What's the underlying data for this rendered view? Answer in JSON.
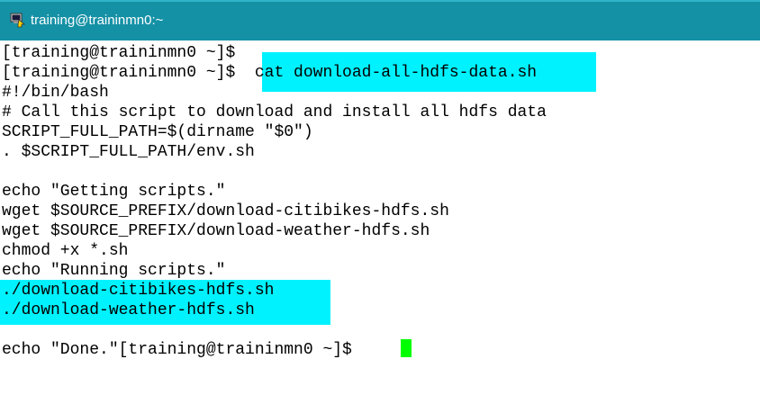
{
  "window": {
    "title": "training@traininmn0:~",
    "icon": "putty-terminal-icon",
    "colors": {
      "titlebar": "#1591a6",
      "highlight": "#00f2ff",
      "cursor": "#00ff00"
    }
  },
  "terminal": {
    "lines": [
      "[training@traininmn0 ~]$",
      "[training@traininmn0 ~]$  cat download-all-hdfs-data.sh",
      "#!/bin/bash",
      "# Call this script to download and install all hdfs data",
      "SCRIPT_FULL_PATH=$(dirname \"$0\")",
      ". $SCRIPT_FULL_PATH/env.sh",
      "",
      "echo \"Getting scripts.\"",
      "wget $SOURCE_PREFIX/download-citibikes-hdfs.sh",
      "wget $SOURCE_PREFIX/download-weather-hdfs.sh",
      "chmod +x *.sh",
      "echo \"Running scripts.\"",
      "./download-citibikes-hdfs.sh",
      "./download-weather-hdfs.sh",
      "",
      "echo \"Done.\"[training@traininmn0 ~]$ "
    ]
  }
}
